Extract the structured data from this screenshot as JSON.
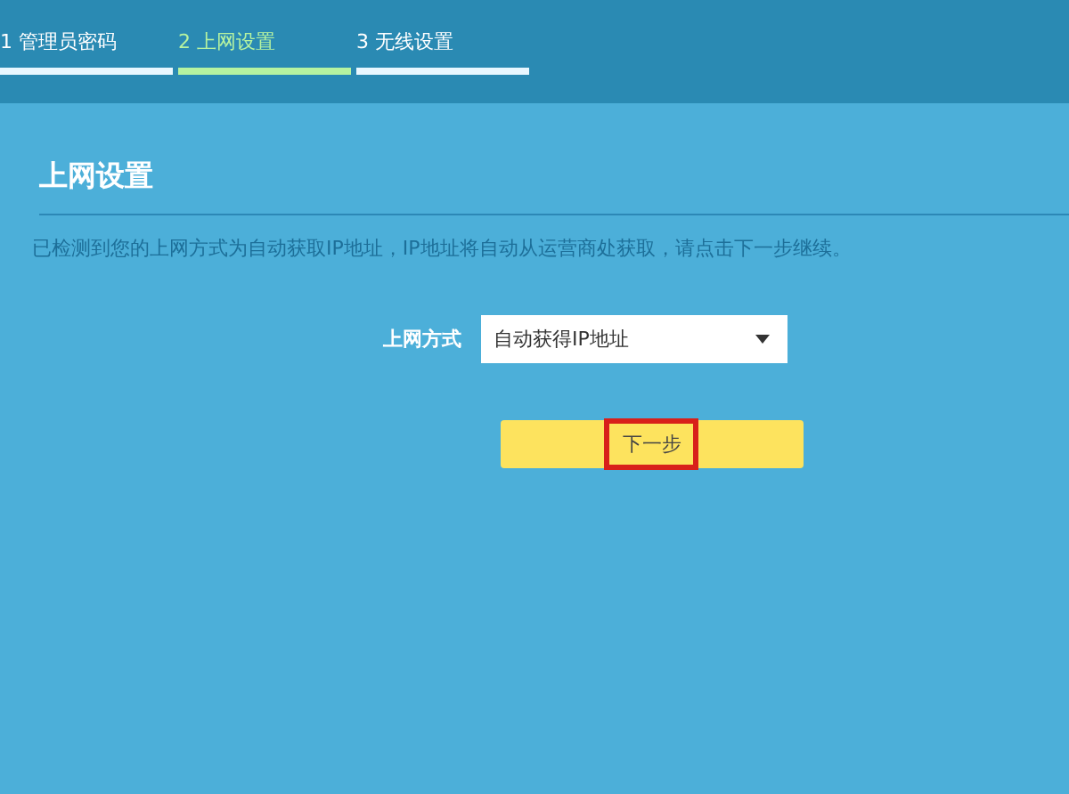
{
  "steps": [
    {
      "label": "1 管理员密码",
      "selected": false
    },
    {
      "label": "2 上网设置",
      "selected": true
    },
    {
      "label": "3 无线设置",
      "selected": false
    }
  ],
  "section": {
    "title": "上网设置",
    "description": "已检测到您的上网方式为自动获取IP地址，IP地址将自动从运营商处获取，请点击下一步继续。"
  },
  "form": {
    "label": "上网方式",
    "value": "自动获得IP地址"
  },
  "next_button": {
    "label": "下一步",
    "highlighted": true
  }
}
